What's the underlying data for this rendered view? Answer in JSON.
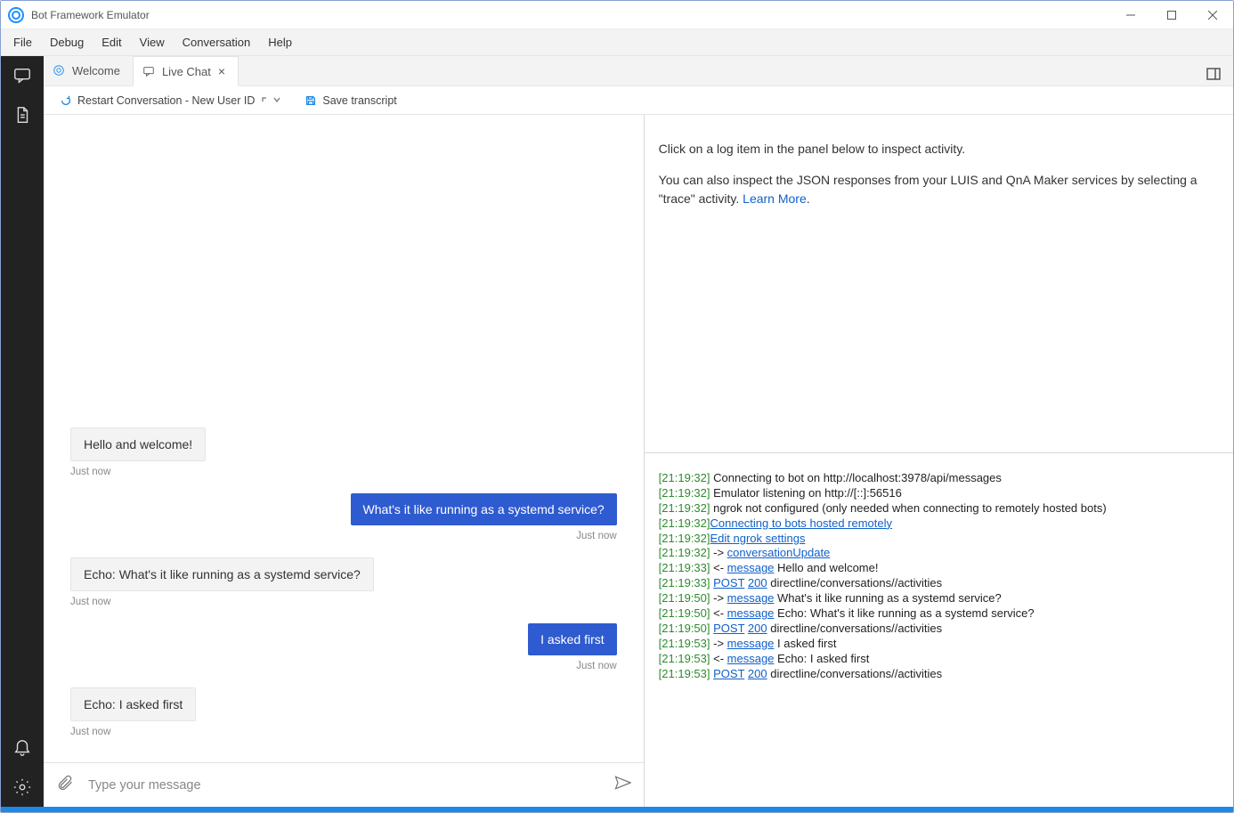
{
  "titlebar": {
    "title": "Bot Framework Emulator"
  },
  "menu": {
    "items": [
      "File",
      "Debug",
      "Edit",
      "View",
      "Conversation",
      "Help"
    ]
  },
  "tabs": {
    "items": [
      {
        "label": "Welcome",
        "active": false,
        "closable": false,
        "icon": "target"
      },
      {
        "label": "Live Chat",
        "active": true,
        "closable": true,
        "icon": "chat"
      }
    ]
  },
  "toolbar": {
    "restart_label": "Restart Conversation - New User ID",
    "save_label": "Save transcript"
  },
  "chat": {
    "input_placeholder": "Type your message",
    "messages": [
      {
        "from": "bot",
        "text": "Hello and welcome!",
        "ts": "Just now"
      },
      {
        "from": "user",
        "text": "What's it like running as a systemd service?",
        "ts": "Just now"
      },
      {
        "from": "bot",
        "text": "Echo: What's it like running as a systemd service?",
        "ts": "Just now"
      },
      {
        "from": "user",
        "text": "I asked first",
        "ts": "Just now"
      },
      {
        "from": "bot",
        "text": "Echo: I asked first",
        "ts": "Just now"
      }
    ]
  },
  "inspector": {
    "hint1": "Click on a log item in the panel below to inspect activity.",
    "hint2": "You can also inspect the JSON responses from your LUIS and QnA Maker services by selecting a \"trace\" activity. ",
    "learn_more": "Learn More"
  },
  "log": {
    "lines": [
      {
        "t": "[21:19:32]",
        "text": " Connecting to bot on http://localhost:3978/api/messages"
      },
      {
        "t": "[21:19:32]",
        "text": " Emulator listening on http://[::]:56516"
      },
      {
        "t": "[21:19:32]",
        "text": " ngrok not configured (only needed when connecting to remotely hosted bots)"
      },
      {
        "t": "[21:19:32]",
        "link": "Connecting to bots hosted remotely"
      },
      {
        "t": "[21:19:32]",
        "link": "Edit ngrok settings"
      },
      {
        "t": "[21:19:32]",
        "text": " -> ",
        "link": "conversationUpdate"
      },
      {
        "t": "[21:19:33]",
        "text": " <- ",
        "link": "message",
        "tail": " Hello and welcome!"
      },
      {
        "t": "[21:19:33]",
        "post": true,
        "tail": " directline/conversations/<conversationId>/activities"
      },
      {
        "t": "[21:19:50]",
        "text": " -> ",
        "link": "message",
        "tail": " What's it like running as a systemd service?"
      },
      {
        "t": "[21:19:50]",
        "text": " <- ",
        "link": "message",
        "tail": " Echo: What's it like running as a systemd service?"
      },
      {
        "t": "[21:19:50]",
        "post": true,
        "tail": " directline/conversations/<conversationId>/activities"
      },
      {
        "t": "[21:19:53]",
        "text": " -> ",
        "link": "message",
        "tail": " I asked first"
      },
      {
        "t": "[21:19:53]",
        "text": " <- ",
        "link": "message",
        "tail": " Echo: I asked first"
      },
      {
        "t": "[21:19:53]",
        "post": true,
        "tail": " directline/conversations/<conversationId>/activities"
      }
    ],
    "post_label": "POST",
    "post_code": "200"
  }
}
